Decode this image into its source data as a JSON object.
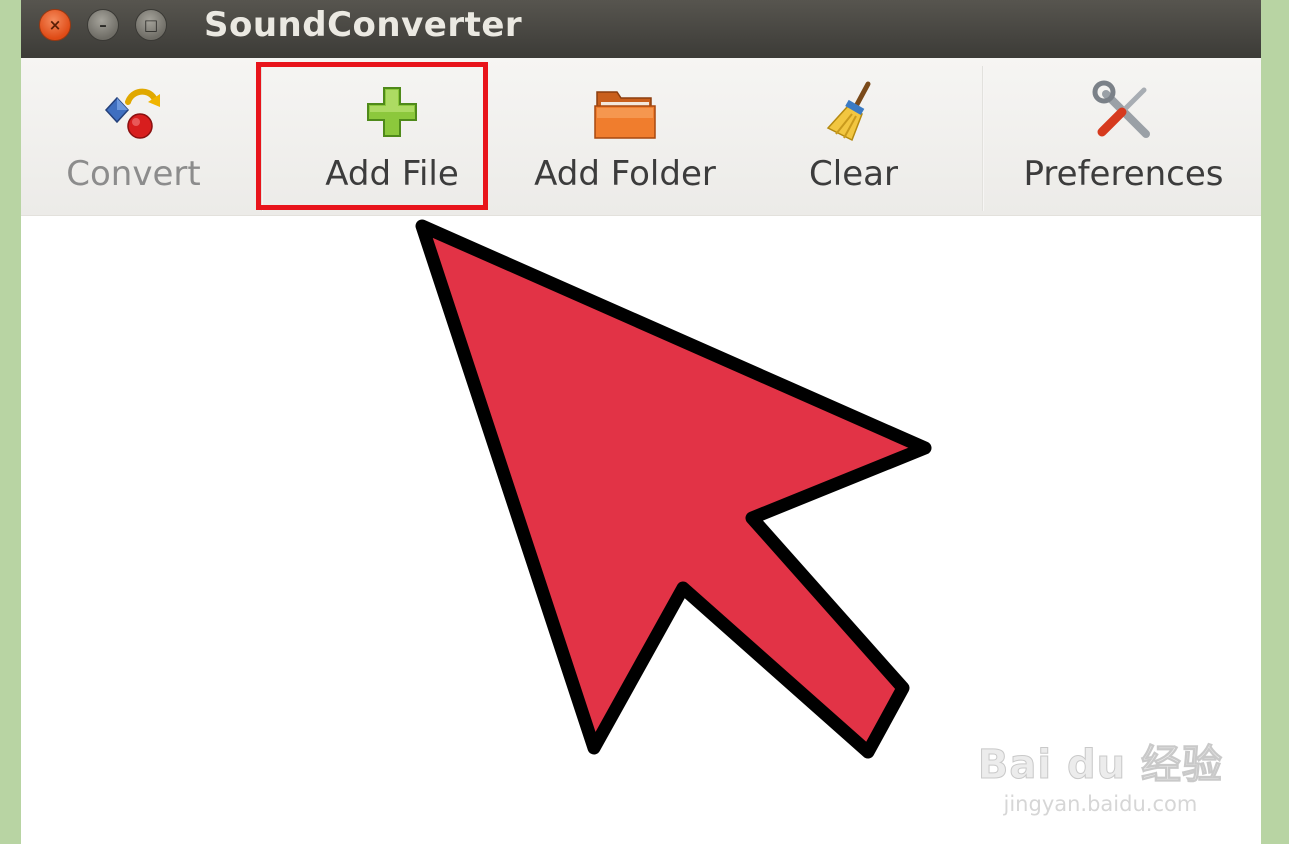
{
  "window": {
    "title": "SoundConverter",
    "controls": {
      "close_glyph": "×",
      "minimize_glyph": "–",
      "maximize_glyph": "□"
    }
  },
  "toolbar": {
    "items": [
      {
        "label": "Convert",
        "icon": "convert-icon",
        "enabled": false
      },
      {
        "label": "Add File",
        "icon": "add-plus-icon",
        "enabled": true,
        "highlighted": true
      },
      {
        "label": "Add Folder",
        "icon": "folder-icon",
        "enabled": true
      },
      {
        "label": "Clear",
        "icon": "broom-icon",
        "enabled": true
      },
      {
        "label": "Preferences",
        "icon": "tools-icon",
        "enabled": true
      }
    ]
  },
  "annotation": {
    "type": "pointer-arrow",
    "color": "#e23346",
    "outline": "#000000",
    "highlight_color": "#e8141b"
  },
  "watermark": {
    "brand": "Bai du 经验",
    "url": "jingyan.baidu.com"
  }
}
